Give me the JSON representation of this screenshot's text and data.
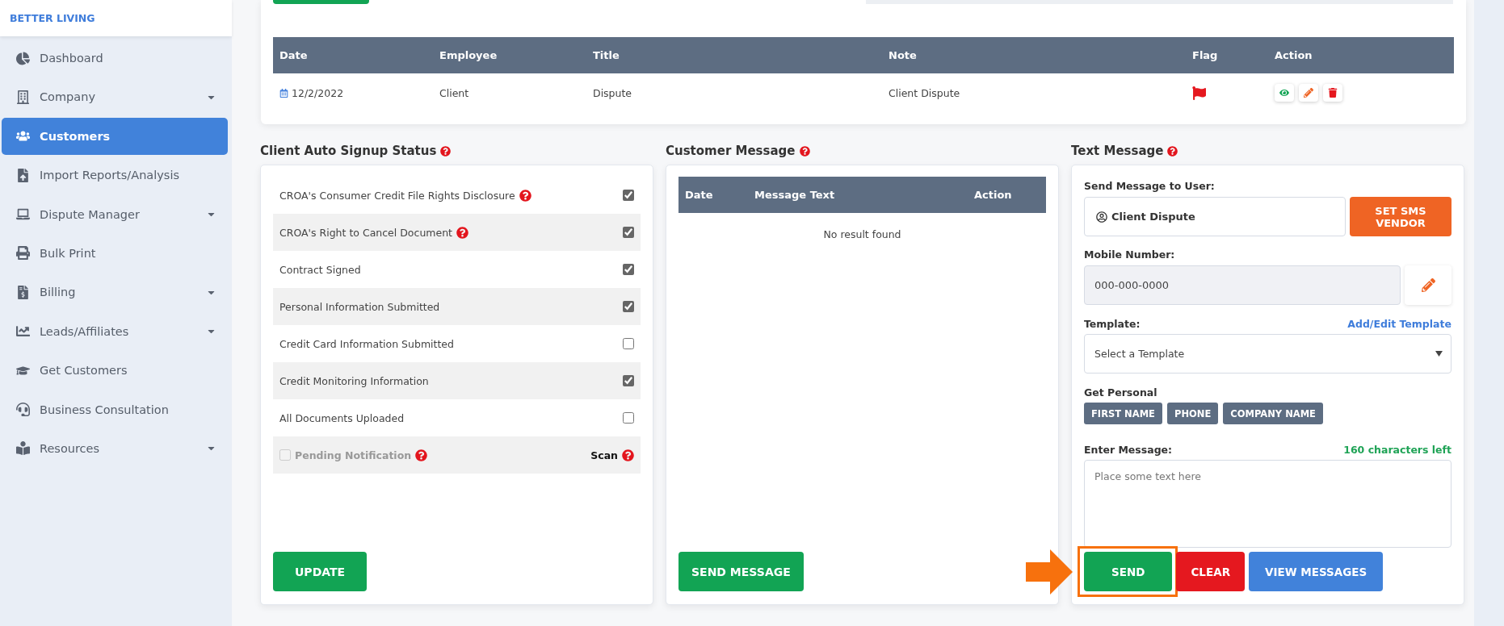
{
  "sidebar": {
    "brand": "BETTER LIVING",
    "items": [
      {
        "label": "Dashboard",
        "selected": false,
        "has_dropdown": false
      },
      {
        "label": "Company",
        "selected": false,
        "has_dropdown": true
      },
      {
        "label": "Customers",
        "selected": true,
        "has_dropdown": false
      },
      {
        "label": "Import Reports/Analysis",
        "selected": false,
        "has_dropdown": false
      },
      {
        "label": "Dispute Manager",
        "selected": false,
        "has_dropdown": true
      },
      {
        "label": "Bulk Print",
        "selected": false,
        "has_dropdown": false
      },
      {
        "label": "Billing",
        "selected": false,
        "has_dropdown": true
      },
      {
        "label": "Leads/Affiliates",
        "selected": false,
        "has_dropdown": true
      },
      {
        "label": "Get Customers",
        "selected": false,
        "has_dropdown": false
      },
      {
        "label": "Business Consultation",
        "selected": false,
        "has_dropdown": false
      },
      {
        "label": "Resources",
        "selected": false,
        "has_dropdown": true
      }
    ]
  },
  "history": {
    "columns": [
      "Date",
      "Employee",
      "Title",
      "Note",
      "Flag",
      "Action"
    ],
    "rows": [
      {
        "date": "12/2/2022",
        "employee": "Client",
        "title": "Dispute",
        "note": "Client Dispute",
        "flagged": true
      }
    ]
  },
  "signup_status": {
    "title": "Client Auto Signup Status",
    "items": [
      {
        "label": "CROA's Consumer Credit File Rights Disclosure",
        "help": true,
        "checked": true
      },
      {
        "label": "CROA's Right to Cancel Document",
        "help": true,
        "checked": true
      },
      {
        "label": "Contract Signed",
        "help": false,
        "checked": true
      },
      {
        "label": "Personal Information Submitted",
        "help": false,
        "checked": true
      },
      {
        "label": "Credit Card Information Submitted",
        "help": false,
        "checked": false
      },
      {
        "label": "Credit Monitoring Information",
        "help": false,
        "checked": true
      },
      {
        "label": "All Documents Uploaded",
        "help": false,
        "checked": false
      }
    ],
    "pending": {
      "label": "Pending Notification",
      "checked": false,
      "disabled": true,
      "scan": "Scan"
    },
    "button": "UPDATE"
  },
  "customer_message": {
    "title": "Customer Message",
    "columns": [
      "Date",
      "Message Text",
      "Action"
    ],
    "empty": "No result found",
    "button": "SEND MESSAGE"
  },
  "text_message": {
    "title": "Text Message",
    "to_label": "Send Message to User:",
    "to_value": "Client Dispute",
    "vendor_button": "SET SMS VENDOR",
    "mobile_label": "Mobile Number:",
    "mobile_value": "000-000-0000",
    "template_label": "Template:",
    "template_link": "Add/Edit Template",
    "template_value": "Select a Template",
    "personal_label": "Get Personal",
    "tags": [
      "FIRST NAME",
      "PHONE",
      "COMPANY NAME"
    ],
    "message_label": "Enter Message:",
    "chars_left": "160 characters left",
    "message_placeholder": "Place some text here",
    "buttons": [
      {
        "label": "SEND",
        "kind": "send",
        "highlighted": true
      },
      {
        "label": "CLEAR",
        "kind": "clear",
        "highlighted": false
      },
      {
        "label": "VIEW MESSAGES",
        "kind": "view",
        "highlighted": false
      }
    ]
  }
}
